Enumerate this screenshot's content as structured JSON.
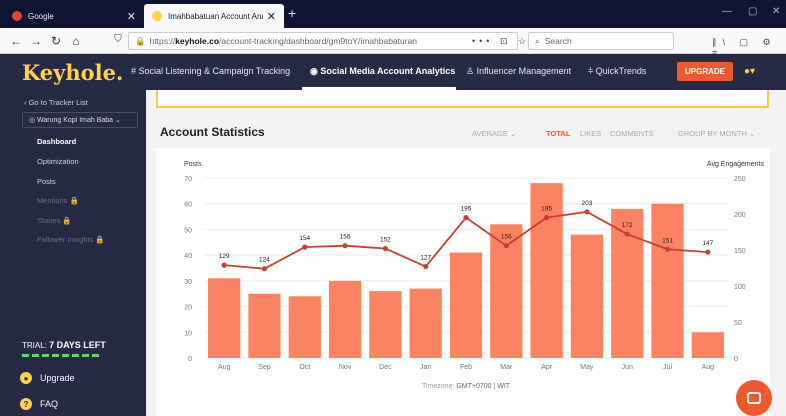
{
  "browser": {
    "tabs": [
      {
        "title": "Google"
      },
      {
        "title": "Imahbabatuan Account Analyti..."
      }
    ],
    "new_tab": "+",
    "url_prefix": "https://",
    "url_domain": "keyhole.co",
    "url_path": "/account-tracking/dashboard/gm9toY/imahbabaturan",
    "search_placeholder": "Search",
    "url_actions": "••• ⊡ ☆",
    "toolbar_icons": "∥\\ ▢ ⚙ ≡"
  },
  "header": {
    "logo": "Keyhole.",
    "nav": [
      {
        "label": "# Social Listening & Campaign Tracking"
      },
      {
        "label": "◉ Social Media Account Analytics"
      },
      {
        "label": "♙ Influencer Management"
      },
      {
        "label": "⫩ QuickTrends"
      }
    ],
    "upgrade_label": "UPGRADE",
    "user_icon": "●▾"
  },
  "sidebar": {
    "back": "‹  Go to Tracker List",
    "project": "◎  Warung Kopi Imah Baba  ⌄",
    "items": [
      {
        "label": "Dashboard"
      },
      {
        "label": "Optimization"
      },
      {
        "label": "Posts"
      },
      {
        "label": "Mentions  🔒"
      },
      {
        "label": "Stories  🔒"
      },
      {
        "label": "Follower Insights  🔒"
      }
    ],
    "trial_prefix": "TRIAL: ",
    "trial_days": "7 DAYS LEFT",
    "upgrade": "Upgrade",
    "faq": "FAQ"
  },
  "account_stats": {
    "title": "Account Statistics",
    "controls": {
      "average": "AVERAGE  ⌄",
      "total": "TOTAL",
      "likes": "LIKES",
      "comments": "COMMENTS",
      "group_by": "GROUP BY MONTH  ⌄"
    }
  },
  "chart_data": {
    "type": "bar",
    "categories": [
      "Aug",
      "Sep",
      "Oct",
      "Nov",
      "Dec",
      "Jan",
      "Feb",
      "Mar",
      "Apr",
      "May",
      "Jun",
      "Jul",
      "Aug"
    ],
    "ylabel_left": "Posts",
    "ylabel_right": "Avg Engagements",
    "ylim_left": [
      0,
      70
    ],
    "ylim_right": [
      0,
      250
    ],
    "yticks_left": [
      0,
      10,
      20,
      30,
      40,
      50,
      60,
      70
    ],
    "yticks_right": [
      0,
      50,
      100,
      150,
      200,
      250
    ],
    "series": [
      {
        "type": "bar",
        "axis": "left",
        "color": "#fb8262",
        "values": [
          31,
          25,
          24,
          30,
          26,
          27,
          41,
          52,
          68,
          48,
          58,
          60,
          10
        ]
      },
      {
        "type": "line",
        "axis": "right",
        "color": "#c8402e",
        "values": [
          129,
          124,
          154,
          156,
          152,
          127,
          195,
          156,
          195,
          203,
          172,
          151,
          147
        ]
      }
    ],
    "timezone_label": "Timezone: ",
    "timezone_value": "GMT+0700 | WIT"
  }
}
